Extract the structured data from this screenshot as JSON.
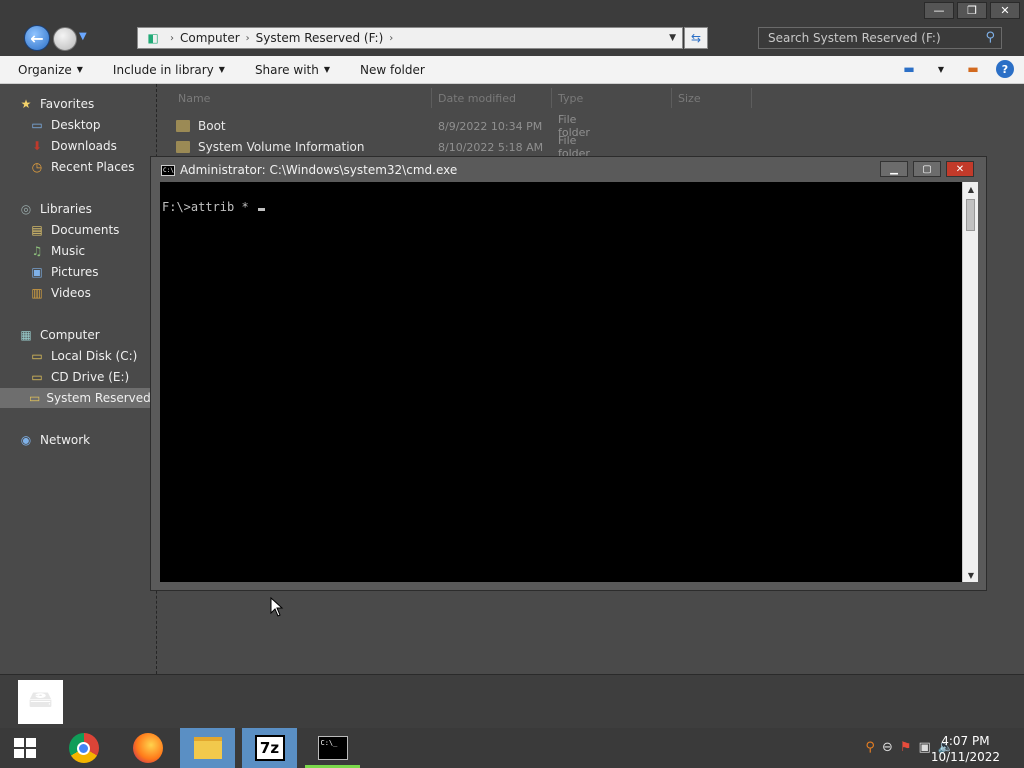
{
  "window_controls": {
    "minimize": "—",
    "maximize": "❐",
    "close": "✕"
  },
  "address_bar": {
    "crumbs": [
      "Computer",
      "System Reserved (F:)"
    ],
    "refresh_icon": "refresh-icon"
  },
  "search": {
    "placeholder": "Search System Reserved (F:)"
  },
  "toolbar": {
    "organize": "Organize",
    "include_in_library": "Include in library",
    "share_with": "Share with",
    "new_folder": "New folder"
  },
  "nav_pane": {
    "favorites": {
      "label": "Favorites",
      "items": [
        "Desktop",
        "Downloads",
        "Recent Places"
      ]
    },
    "libraries": {
      "label": "Libraries",
      "items": [
        "Documents",
        "Music",
        "Pictures",
        "Videos"
      ]
    },
    "computer": {
      "label": "Computer",
      "items": [
        "Local Disk (C:)",
        "CD Drive (E:)",
        "System Reserved (F:)"
      ]
    },
    "network": {
      "label": "Network"
    }
  },
  "file_list": {
    "columns": [
      "Name",
      "Date modified",
      "Type",
      "Size"
    ],
    "rows": [
      {
        "name": "Boot",
        "date": "8/9/2022 10:34 PM",
        "type": "File folder"
      },
      {
        "name": "System Volume Information",
        "date": "8/10/2022 5:18 AM",
        "type": "File folder"
      }
    ]
  },
  "cmd": {
    "title": "Administrator: C:\\Windows\\system32\\cmd.exe",
    "text": "F:\\>attrib * ",
    "controls": {
      "minimize": "▁",
      "maximize": "▢",
      "close": "✕"
    }
  },
  "taskbar": {
    "apps": [
      "chrome",
      "firefox",
      "file-explorer",
      "7zip",
      "cmd"
    ],
    "sz_label": "7z",
    "clock": {
      "time": "4:07 PM",
      "date": "10/11/2022"
    }
  }
}
